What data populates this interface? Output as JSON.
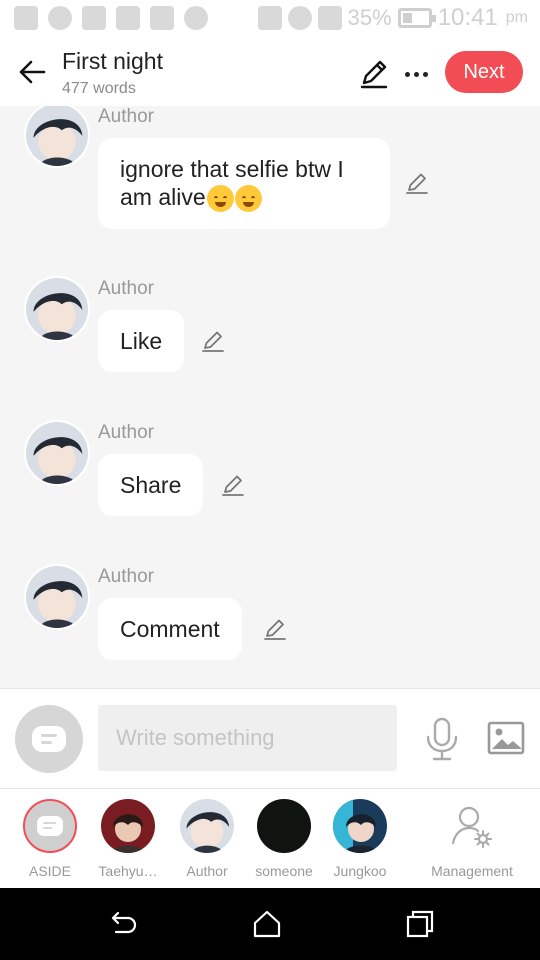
{
  "status_bar": {
    "battery_percent": "35%",
    "battery_level": 0.35,
    "time": "10:41",
    "ampm": "pm",
    "icons": [
      "add-icon",
      "whatsapp-icon",
      "message-icon",
      "calendar-icon",
      "warning-icon",
      "cloud-icon",
      "mute-icon",
      "wifi-icon",
      "sim-icon",
      "battery-icon"
    ]
  },
  "header": {
    "title": "First night",
    "word_count": "477 words",
    "next_label": "Next",
    "accent": "#f24d55"
  },
  "messages": [
    {
      "author": "Author",
      "text": "ignore that selfie btw I am alive",
      "emojis": [
        "smiling-face-emoji",
        "smiling-face-emoji"
      ]
    },
    {
      "author": "Author",
      "text": "Like"
    },
    {
      "author": "Author",
      "text": "Share"
    },
    {
      "author": "Author",
      "text": "Comment"
    }
  ],
  "input": {
    "placeholder": "Write something",
    "value": ""
  },
  "characters": [
    {
      "label": "ASIDE",
      "selected": true
    },
    {
      "label": "Taehyu…"
    },
    {
      "label": "Author"
    },
    {
      "label": "someone"
    },
    {
      "label": "Jungkoo"
    },
    {
      "label": "Management"
    }
  ]
}
